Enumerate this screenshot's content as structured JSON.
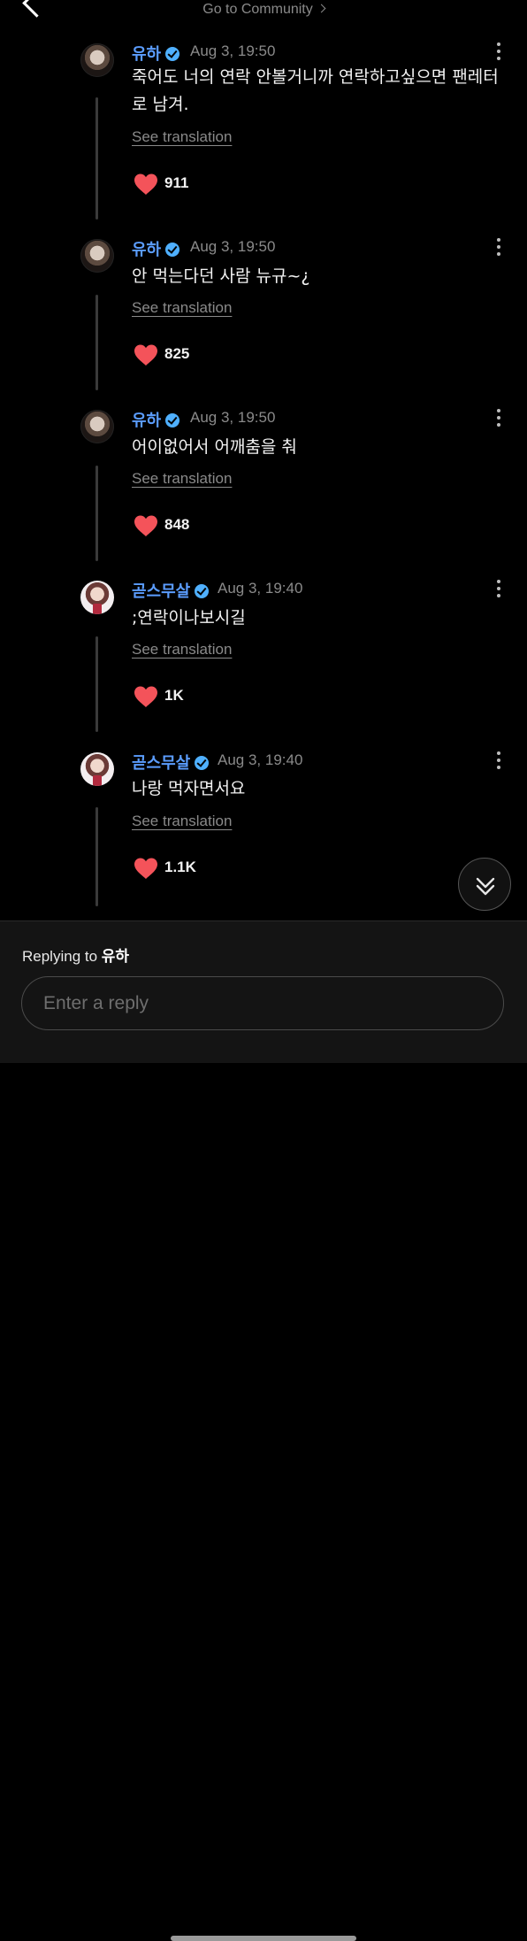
{
  "header": {
    "community_link": "Go to Community",
    "back_icon": "back-arrow-icon"
  },
  "comments": [
    {
      "author": "유하",
      "verified": true,
      "time": "Aug 3, 19:50",
      "text": "죽어도 너의 연락 안볼거니까 연락하고싶으면 팬레터로 남겨.",
      "translate_label": "See translation",
      "likes": "911"
    },
    {
      "author": "유하",
      "verified": true,
      "time": "Aug 3, 19:50",
      "text": "안 먹는다던 사람 뉴규~¿",
      "translate_label": "See translation",
      "likes": "825"
    },
    {
      "author": "유하",
      "verified": true,
      "time": "Aug 3, 19:50",
      "text": "어이없어서 어깨춤을 춰",
      "translate_label": "See translation",
      "likes": "848"
    },
    {
      "author": "곧스무살",
      "verified": true,
      "time": "Aug 3, 19:40",
      "text": ";연락이나보시길",
      "translate_label": "See translation",
      "likes": "1K"
    },
    {
      "author": "곧스무살",
      "verified": true,
      "time": "Aug 3, 19:40",
      "text": "나랑 먹자면서요",
      "translate_label": "See translation",
      "likes": "1.1K"
    }
  ],
  "reply_bar": {
    "replying_to_prefix": "Replying to",
    "replying_to_name": "유하",
    "input_placeholder": "Enter a reply",
    "input_value": ""
  },
  "colors": {
    "background": "#000000",
    "username": "#5b9dff",
    "verified_badge": "#4fb0ff",
    "heart": "#f4535a",
    "muted_text": "#8a8a8a"
  }
}
